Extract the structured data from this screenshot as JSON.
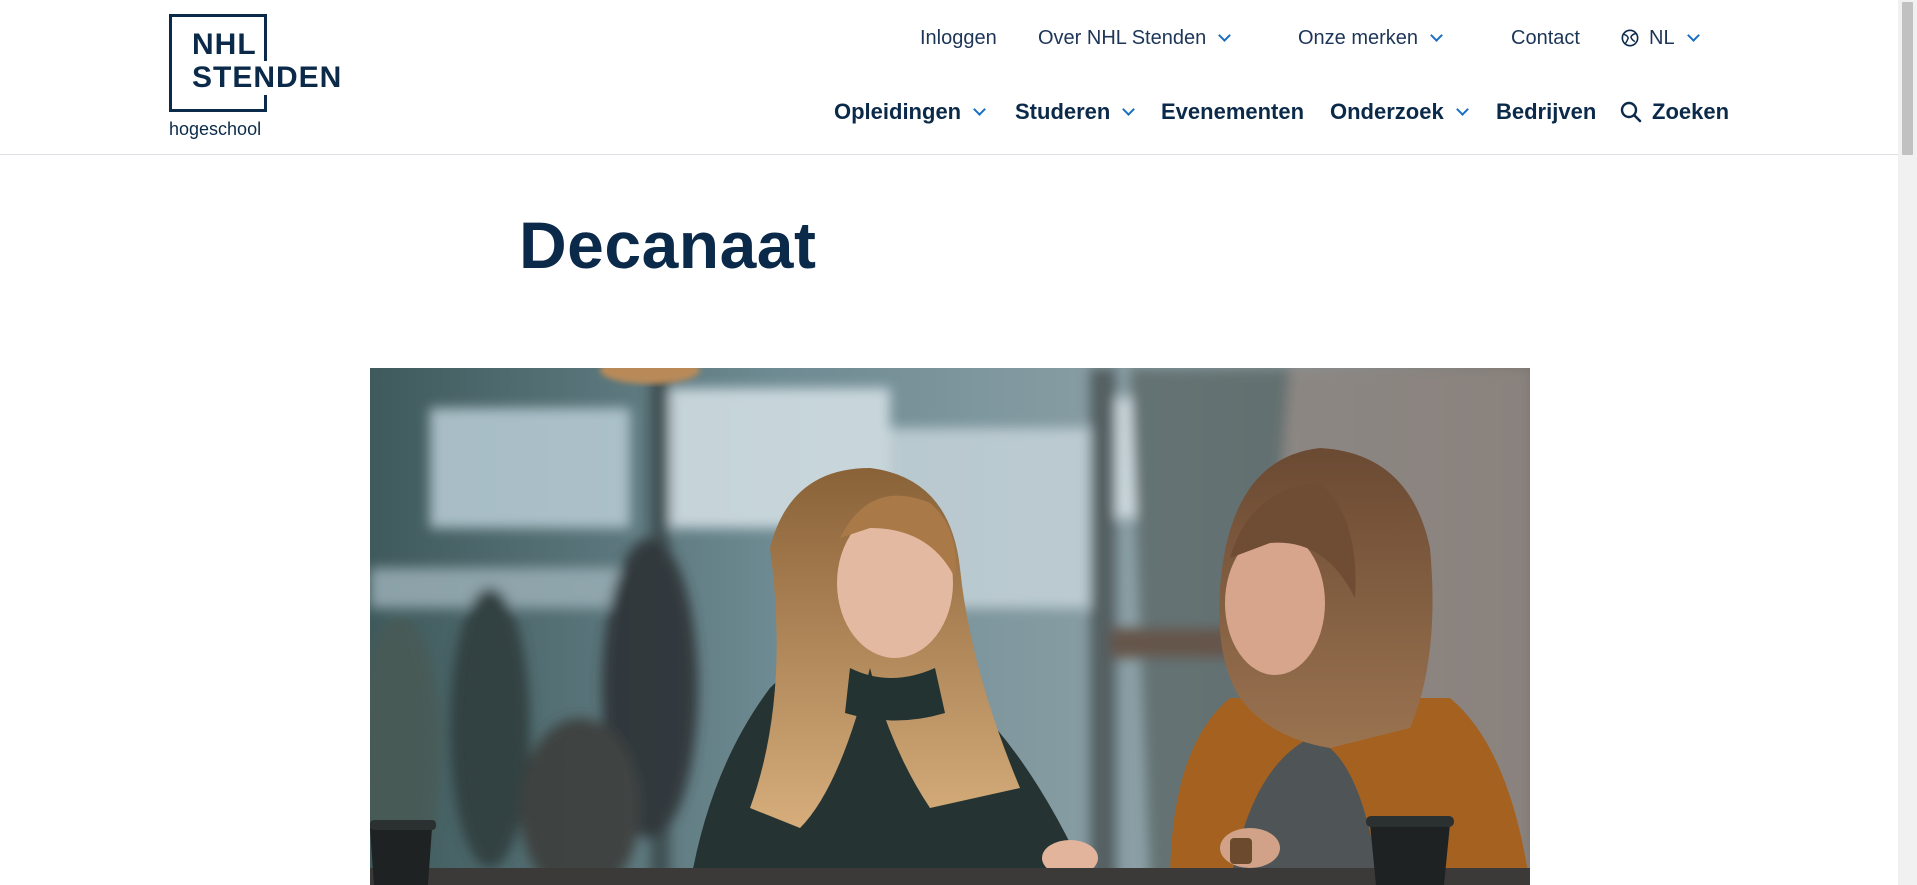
{
  "brand": {
    "line1": "NHL",
    "line2": "STENDEN",
    "sub": "hogeschool"
  },
  "top_nav": {
    "login": "Inloggen",
    "about": "Over NHL Stenden",
    "brands": "Onze merken",
    "contact": "Contact",
    "language": "NL"
  },
  "main_nav": {
    "programs": "Opleidingen",
    "studying": "Studeren",
    "events": "Evenementen",
    "research": "Onderzoek",
    "companies": "Bedrijven",
    "search": "Zoeken"
  },
  "page": {
    "title": "Decanaat"
  },
  "colors": {
    "navy": "#0b2a4a",
    "accent": "#1a6fc4"
  },
  "icons": {
    "language": "globe-icon",
    "search": "search-icon",
    "dropdown": "chevron-down-icon"
  }
}
